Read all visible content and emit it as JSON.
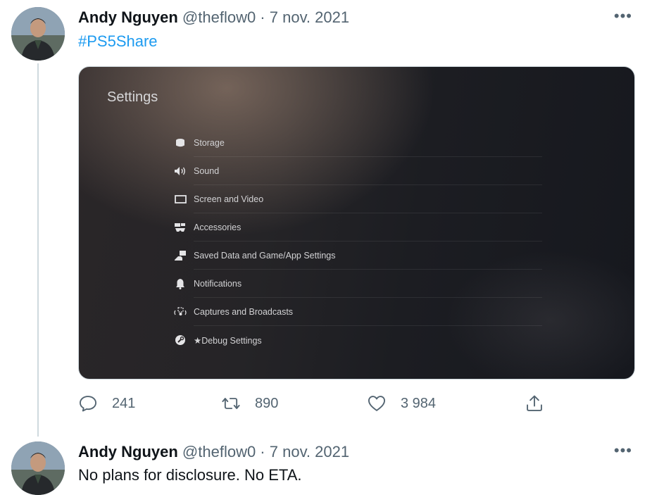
{
  "tweets": [
    {
      "author_name": "Andy Nguyen",
      "meta": "@theflow0 · 7 nov. 2021",
      "more_icon": "more-icon",
      "hashtag": "#PS5Share",
      "media": {
        "title": "Settings",
        "items": [
          {
            "label": "Storage",
            "icon": "storage-icon"
          },
          {
            "label": "Sound",
            "icon": "sound-icon"
          },
          {
            "label": "Screen and Video",
            "icon": "screen-icon"
          },
          {
            "label": "Accessories",
            "icon": "accessories-icon"
          },
          {
            "label": "Saved Data and Game/App Settings",
            "icon": "saved-data-icon"
          },
          {
            "label": "Notifications",
            "icon": "bell-icon"
          },
          {
            "label": "Captures and Broadcasts",
            "icon": "captures-icon"
          },
          {
            "label": "★Debug Settings",
            "icon": "debug-icon"
          }
        ]
      },
      "actions": {
        "reply_count": "241",
        "retweet_count": "890",
        "like_count": "3 984"
      }
    },
    {
      "author_name": "Andy Nguyen",
      "meta": "@theflow0 · 7 nov. 2021",
      "text": "No plans for disclosure. No ETA."
    }
  ],
  "colors": {
    "link": "#1d9bf0",
    "muted": "#536471",
    "text": "#0f1419"
  }
}
